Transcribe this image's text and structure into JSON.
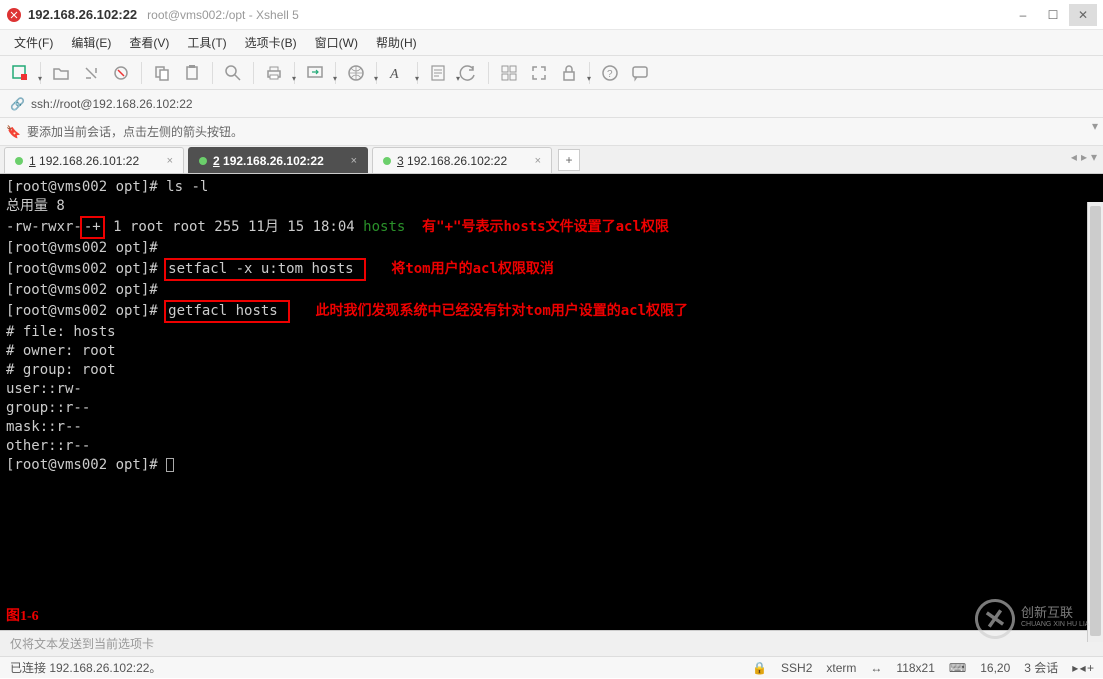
{
  "title": {
    "main": "192.168.26.102:22",
    "sub": "root@vms002:/opt - Xshell 5"
  },
  "wc": {
    "min": "–",
    "max": "☐",
    "close": "✕"
  },
  "menu": [
    "文件(F)",
    "编辑(E)",
    "查看(V)",
    "工具(T)",
    "选项卡(B)",
    "窗口(W)",
    "帮助(H)"
  ],
  "address": {
    "url": "ssh://root@192.168.26.102:22"
  },
  "hint": {
    "text": "要添加当前会话，点击左侧的箭头按钮。"
  },
  "tabs": {
    "items": [
      {
        "label": "1 192.168.26.101:22",
        "active": false
      },
      {
        "label": "2 192.168.26.102:22",
        "active": true
      },
      {
        "label": "3 192.168.26.102:22",
        "active": false
      }
    ],
    "add": "+"
  },
  "terminal": {
    "l1_prompt": "[root@vms002 opt]# ",
    "l1_cmd": "ls -l",
    "l2": "总用量 8",
    "l3_a": "-rw-rwxr-",
    "l3_b": "-+",
    "l3_c": " 1 root root 255 11月 15 18:04 ",
    "l3_file": "hosts",
    "l3_note": "  有\"+\"号表示hosts文件设置了acl权限",
    "l4": "[root@vms002 opt]#",
    "l5_prompt": "[root@vms002 opt]# ",
    "l5_box": "setfacl -x u:tom hosts ",
    "l5_note": "   将tom用户的acl权限取消",
    "l6": "[root@vms002 opt]#",
    "l7_prompt": "[root@vms002 opt]# ",
    "l7_box": "getfacl hosts ",
    "l7_note": "   此时我们发现系统中已经没有针对tom用户设置的acl权限了",
    "l8": "# file: hosts",
    "l9": "# owner: root",
    "l10": "# group: root",
    "l11": "user::rw-",
    "l12": "group::r--",
    "l13": "mask::r--",
    "l14": "other::r--",
    "l15": "",
    "l16_prompt": "[root@vms002 opt]# ",
    "figlabel": "图1-6"
  },
  "sendbar": {
    "placeholder": "仅将文本发送到当前选项卡"
  },
  "status": {
    "conn": "已连接 192.168.26.102:22。",
    "ssh": "SSH2",
    "term": "xterm",
    "size": "118x21",
    "pos": "16,20",
    "sess": "3 会话"
  },
  "watermark": {
    "brand": "创新互联",
    "py": "CHUANG XIN HU LIAN"
  }
}
